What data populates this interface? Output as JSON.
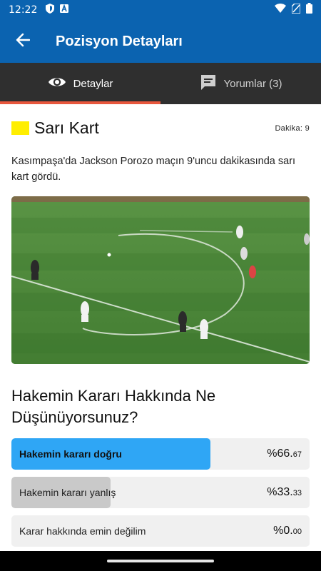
{
  "status_bar": {
    "time": "12:22",
    "icons": [
      "shield-icon",
      "a-badge-icon",
      "wifi-icon",
      "no-sim-icon",
      "battery-icon"
    ]
  },
  "app_bar": {
    "title": "Pozisyon Detayları",
    "back_icon": "arrow-back-icon"
  },
  "tabs": [
    {
      "label": "Detaylar",
      "icon": "eye-icon",
      "active": true
    },
    {
      "label": "Yorumlar (3)",
      "icon": "comment-icon",
      "active": false
    }
  ],
  "event": {
    "title": "Sarı Kart",
    "card_color": "#ffee00",
    "minute_label": "Dakika: 9",
    "description": "Kasımpaşa'da Jackson Porozo maçın 9'uncu dakikasında sarı kart gördü."
  },
  "poll": {
    "question": "Hakemin Kararı Hakkında Ne Düşünüyorsunuz?",
    "options": [
      {
        "label": "Hakemin kararı doğru",
        "pct_main": "%66.",
        "pct_dec": "67",
        "fraction": 0.6667,
        "fill_color": "#2fa6f5",
        "selected": true
      },
      {
        "label": "Hakemin kararı yanlış",
        "pct_main": "%33.",
        "pct_dec": "33",
        "fraction": 0.3333,
        "fill_color": "#c9c9c9",
        "selected": false
      },
      {
        "label": "Karar hakkında emin değilim",
        "pct_main": "%0.",
        "pct_dec": "00",
        "fraction": 0.0,
        "fill_color": "#c9c9c9",
        "selected": false
      }
    ]
  },
  "colors": {
    "primary": "#0b63b0",
    "tab_bg": "#2f2f2f",
    "tab_indicator": "#e8573d",
    "accent": "#2fa6f5"
  }
}
